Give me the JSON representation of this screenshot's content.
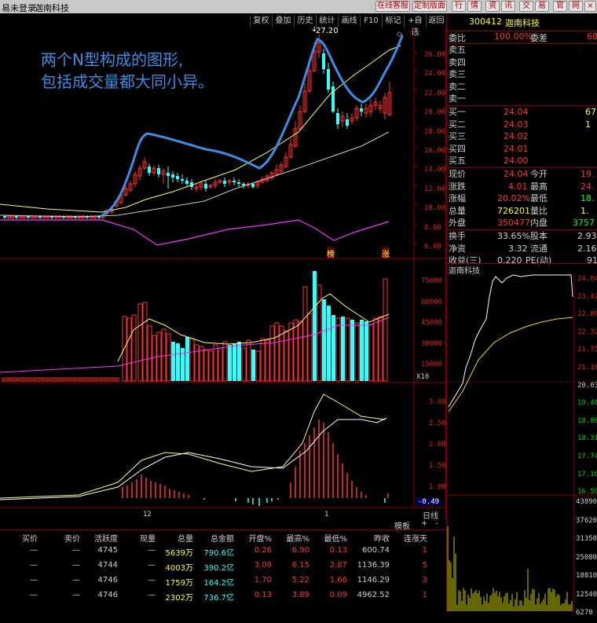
{
  "titlebar": {
    "account_status": "易未登录",
    "stock_name": "迦南科技",
    "buttons": [
      "在线客服",
      "定制版面",
      "行",
      "情",
      "资",
      "讯",
      "交",
      "易",
      "官",
      "网"
    ],
    "close": "×"
  },
  "toolbar": {
    "items": [
      "复权",
      "叠加",
      "历史",
      "统计",
      "画线",
      "F10",
      "标记",
      "+自选",
      "返回"
    ]
  },
  "annotation": {
    "line1": "两个N型构成的图形,",
    "line2": "包括成交量都大同小异。"
  },
  "price_chart": {
    "high_label": "27.20",
    "axis_labels": [
      "26.00",
      "24.00",
      "22.00",
      "20.00",
      "18.00",
      "16.00",
      "14.00",
      "12.00",
      "10.00",
      "8.00",
      "6.00"
    ],
    "tags": [
      "榜",
      "涨"
    ]
  },
  "volume_chart": {
    "axis_labels": [
      "75000",
      "60000",
      "45000",
      "30000",
      "15000"
    ],
    "unit": "X10"
  },
  "macd_chart": {
    "axis_labels": [
      "3.00",
      "2.50",
      "2.00",
      "1.50",
      "1.00"
    ],
    "neg_label": "-0.49"
  },
  "time_axis": {
    "labels": [
      "12",
      "1"
    ],
    "right_label": "日线"
  },
  "chart_bottom_tabs": [
    "模板",
    "+",
    "-"
  ],
  "quote": {
    "code": "300412",
    "name": "迦南科技",
    "weibi_label": "委比",
    "weibi": "100.00%",
    "weicha_label": "委差",
    "weicha": "68",
    "sell": [
      {
        "label": "卖五",
        "price": "",
        "vol": ""
      },
      {
        "label": "卖四",
        "price": "",
        "vol": ""
      },
      {
        "label": "卖三",
        "price": "",
        "vol": ""
      },
      {
        "label": "卖二",
        "price": "",
        "vol": ""
      },
      {
        "label": "卖一",
        "price": "",
        "vol": ""
      }
    ],
    "buy": [
      {
        "label": "买一",
        "price": "24.04",
        "vol": "67"
      },
      {
        "label": "买二",
        "price": "24.03",
        "vol": ""
      },
      {
        "label": "买三",
        "price": "24.02",
        "vol": "1"
      },
      {
        "label": "买四",
        "price": "24.01",
        "vol": ""
      },
      {
        "label": "买五",
        "price": "24.00",
        "vol": ""
      }
    ],
    "stats": [
      {
        "l1": "现价",
        "v1": "24.04",
        "l2": "今开",
        "v2": "19."
      },
      {
        "l1": "涨跌",
        "v1": "4.01",
        "l2": "最高",
        "v2": "24."
      },
      {
        "l1": "涨幅",
        "v1": "20.02%",
        "l2": "最低",
        "v2": "18."
      },
      {
        "l1": "总量",
        "v1": "726201",
        "l2": "量比",
        "v2": "1."
      },
      {
        "l1": "外盘",
        "v1": "350477",
        "l2": "内盘",
        "v2": "3757"
      }
    ],
    "stats2": [
      {
        "l1": "换手",
        "v1": "33.65%",
        "l2": "股本",
        "v2": "2.93"
      },
      {
        "l1": "净资",
        "v1": "3.32",
        "l2": "流通",
        "v2": "2.16"
      },
      {
        "l1": "收益(三)",
        "v1": "0.220",
        "l2": "PE(动)",
        "v2": "91"
      }
    ]
  },
  "intraday": {
    "title": "迦南科技",
    "price_labels": [
      "24.04",
      "23.47",
      "22.89",
      "22.32",
      "21.75",
      "21.18",
      "20.03",
      "19.46",
      "18.88",
      "18.31",
      "17.74",
      "17.16",
      "16.59"
    ],
    "vol_labels": [
      "43890",
      "37620",
      "31350",
      "25080",
      "18810",
      "12540",
      "6270"
    ]
  },
  "bottom_table": {
    "headers": [
      "买价",
      "卖价",
      "活跃度",
      "现量",
      "总量",
      "总金额",
      "开盘%",
      "最高%",
      "最低%",
      "昨收",
      "连涨天"
    ],
    "rows": [
      [
        "—",
        "—",
        "4745",
        "—",
        "5639万",
        "790.6亿",
        "0.26",
        "6.90",
        "0.13",
        "600.74",
        "1"
      ],
      [
        "—",
        "—",
        "4744",
        "—",
        "4003万",
        "390.2亿",
        "3.09",
        "6.15",
        "2.87",
        "1136.39",
        "5"
      ],
      [
        "—",
        "—",
        "4746",
        "—",
        "1759万",
        "164.2亿",
        "1.70",
        "5.22",
        "1.66",
        "1146.29",
        "3"
      ],
      [
        "—",
        "—",
        "4746",
        "—",
        "2302万",
        "736.7亿",
        "0.13",
        "3.89",
        "0.09",
        "4962.52",
        "1"
      ]
    ]
  },
  "colors": {
    "up": "#ff3333",
    "down": "#33ffff",
    "ma_yellow": "#ffff66",
    "ma_magenta": "#ff33ff",
    "blue_annotation": "#3a8ee6",
    "grid_red": "#8b0000"
  }
}
